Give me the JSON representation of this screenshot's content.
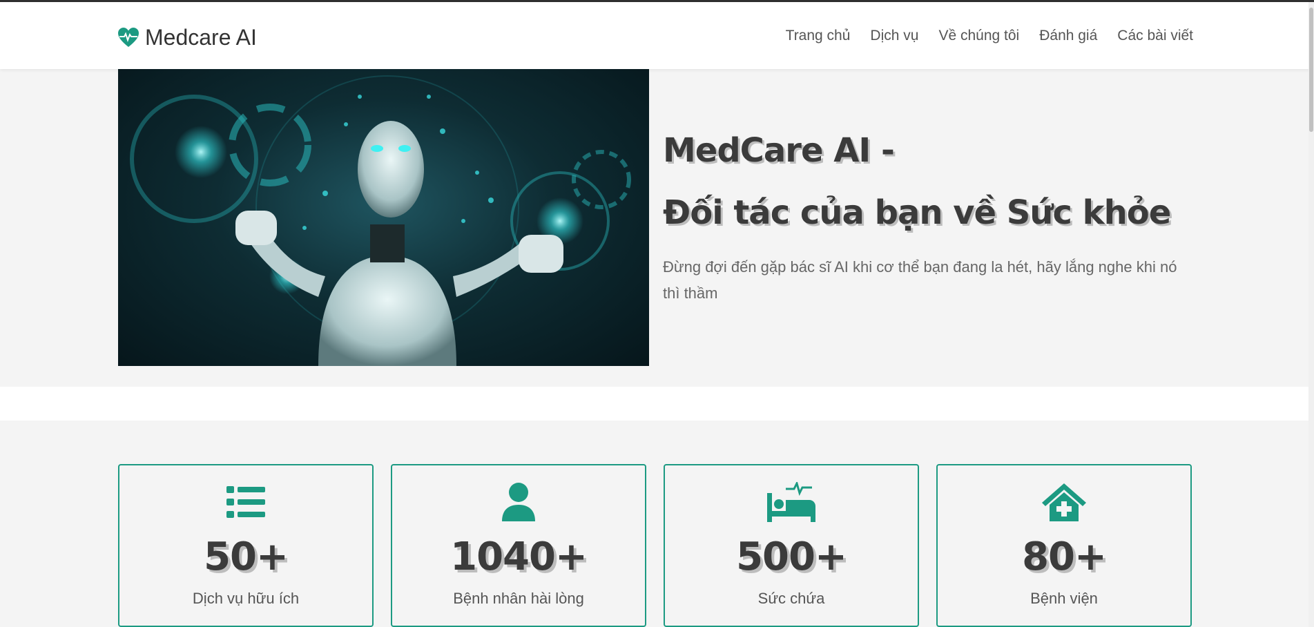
{
  "header": {
    "logo_text": "Medcare AI",
    "logo_icon": "heart-pulse-icon",
    "nav": [
      {
        "label": "Trang chủ"
      },
      {
        "label": "Dịch vụ"
      },
      {
        "label": "Về chúng tôi"
      },
      {
        "label": "Đánh giá"
      },
      {
        "label": "Các bài viết"
      }
    ]
  },
  "hero": {
    "image": "robot-ai-hologram-image",
    "title_line1": "MedCare AI -",
    "title_line2": "Đối tác của bạn về Sức khỏe",
    "subtitle": "Đừng đợi đến gặp bác sĩ AI khi cơ thể bạn đang la hét, hãy lắng nghe khi nó thì thầm"
  },
  "stats": [
    {
      "icon": "list-icon",
      "number": "50+",
      "label": "Dịch vụ hữu ích"
    },
    {
      "icon": "user-icon",
      "number": "1040+",
      "label": "Bệnh nhân hài lòng"
    },
    {
      "icon": "hospital-bed-icon",
      "number": "500+",
      "label": "Sức chứa"
    },
    {
      "icon": "hospital-house-icon",
      "number": "80+",
      "label": "Bệnh viện"
    }
  ],
  "colors": {
    "accent": "#1c9a82",
    "text_dark": "#3b3b3b",
    "background": "#f4f4f4"
  }
}
